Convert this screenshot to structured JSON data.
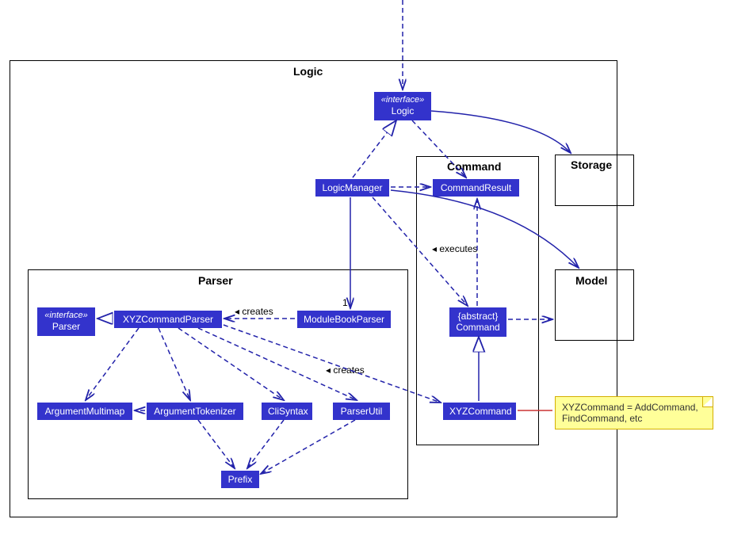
{
  "packages": {
    "logic": "Logic",
    "parser": "Parser",
    "command": "Command",
    "storage": "Storage",
    "model": "Model"
  },
  "classes": {
    "interface_logic_stereo": "«interface»",
    "interface_logic_name": "Logic",
    "logic_manager": "LogicManager",
    "command_result": "CommandResult",
    "abstract_command_stereo": "{abstract}",
    "abstract_command_name": "Command",
    "xyz_command": "XYZCommand",
    "interface_parser_stereo": "«interface»",
    "interface_parser_name": "Parser",
    "xyz_command_parser": "XYZCommandParser",
    "module_book_parser": "ModuleBookParser",
    "argument_multimap": "ArgumentMultimap",
    "argument_tokenizer": "ArgumentTokenizer",
    "cli_syntax": "CliSyntax",
    "parser_util": "ParserUtil",
    "prefix": "Prefix"
  },
  "labels": {
    "executes": "executes",
    "creates1": "creates",
    "creates2": "creates",
    "one": "1"
  },
  "note": {
    "line1": "XYZCommand = AddCommand,",
    "line2": "FindCommand, etc"
  }
}
